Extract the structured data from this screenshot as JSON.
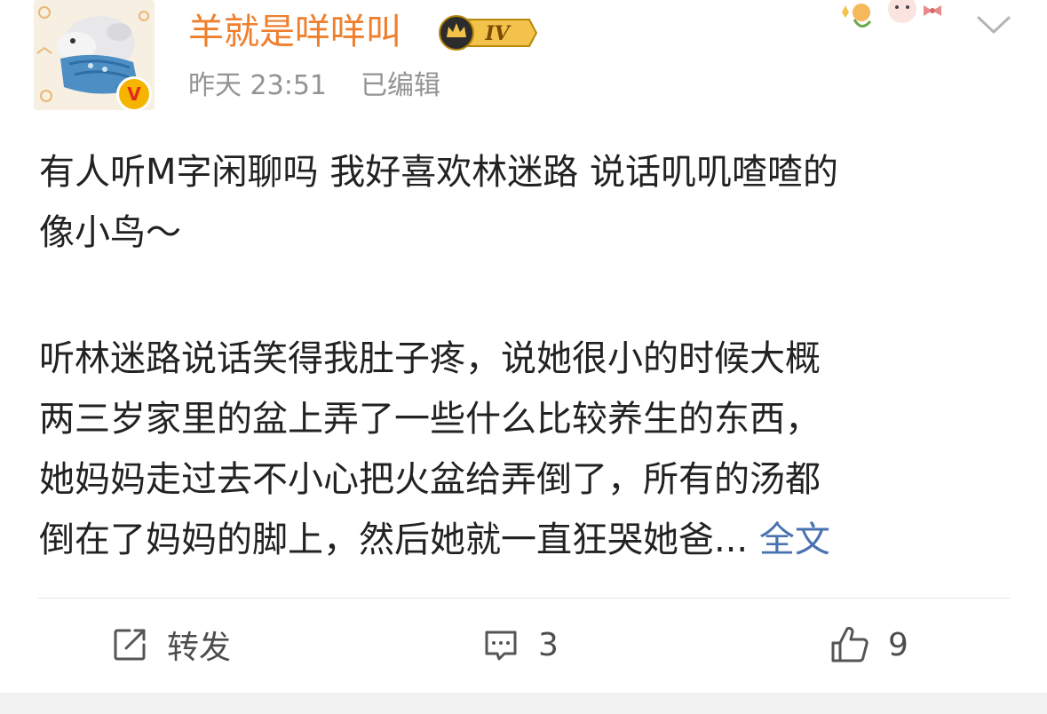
{
  "post": {
    "author": {
      "name": "羊就是咩咩叫",
      "verified_badge": "V",
      "vip_level": "IV"
    },
    "timestamp": "昨天 23:51",
    "edited_label": "已编辑",
    "paragraphs": [
      [
        "有人听M字闲聊吗 我好喜欢林迷路 说话叽叽喳喳的",
        "像小鸟～"
      ],
      [
        "听林迷路说话笑得我肚子疼，说她很小的时候大概",
        "两三岁家里的盆上弄了一些什么比较养生的东西，",
        "她妈妈走过去不小心把火盆给弄倒了，所有的汤都",
        "倒在了妈妈的脚上，然后她就一直狂哭她爸..."
      ]
    ],
    "expand_label": "全文",
    "actions": {
      "repost_label": "转发",
      "comment_count": "3",
      "like_count": "9"
    }
  },
  "icons": {
    "more": "chevron-down-icon",
    "repost": "share-edit-icon",
    "comment": "comment-icon",
    "like": "thumbs-up-icon"
  },
  "colors": {
    "username": "#ef7f2d",
    "link": "#4a72b0",
    "meta": "#939393"
  }
}
